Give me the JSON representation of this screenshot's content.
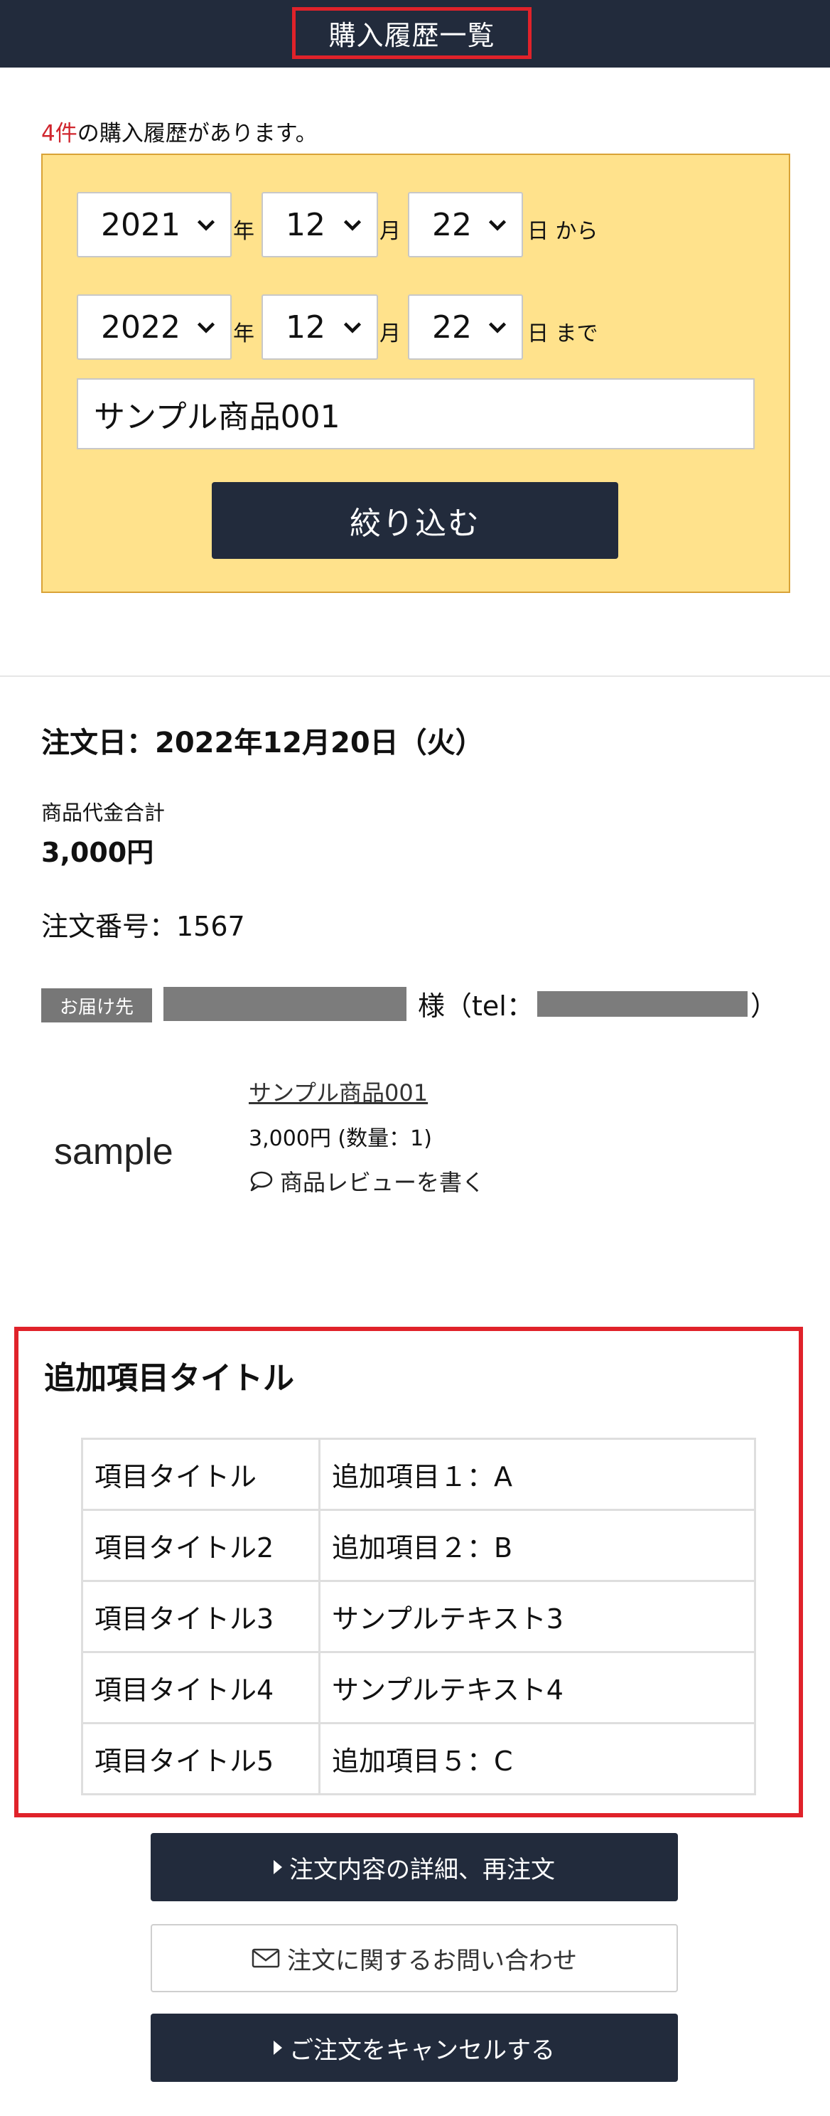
{
  "header": {
    "title": "購入履歴一覧"
  },
  "summary": {
    "count": "4件",
    "suffix": "の購入履歴があります。"
  },
  "filter": {
    "from": {
      "year": "2021",
      "month": "12",
      "day": "22",
      "year_unit": "年",
      "month_unit": "月",
      "day_unit": "日 から"
    },
    "to": {
      "year": "2022",
      "month": "12",
      "day": "22",
      "year_unit": "年",
      "month_unit": "月",
      "day_unit": "日 まで"
    },
    "keyword": "サンプル商品001",
    "submit_label": "絞り込む"
  },
  "order": {
    "date": "注文日：2022年12月20日（火）",
    "total_label": "商品代金合計",
    "total_value": "3,000円",
    "order_number": "注文番号：1567",
    "shipping_badge": "お届け先",
    "shipping_sama": "様（tel：",
    "shipping_close": "）",
    "product": {
      "thumbnail_text": "sample",
      "name": "サンプル商品001",
      "price_qty": "3,000円 (数量：1)",
      "review_label": "商品レビューを書く"
    }
  },
  "extra": {
    "title": "追加項目タイトル",
    "rows": [
      {
        "key": "項目タイトル",
        "value": "追加項目１：A"
      },
      {
        "key": "項目タイトル2",
        "value": "追加項目２：B"
      },
      {
        "key": "項目タイトル3",
        "value": "サンプルテキスト3"
      },
      {
        "key": "項目タイトル4",
        "value": "サンプルテキスト4"
      },
      {
        "key": "項目タイトル5",
        "value": "追加項目５：C"
      }
    ]
  },
  "actions": {
    "detail_label": "注文内容の詳細、再注文",
    "inquiry_label": "注文に関するお問い合わせ",
    "cancel_label": "ご注文をキャンセルする"
  }
}
